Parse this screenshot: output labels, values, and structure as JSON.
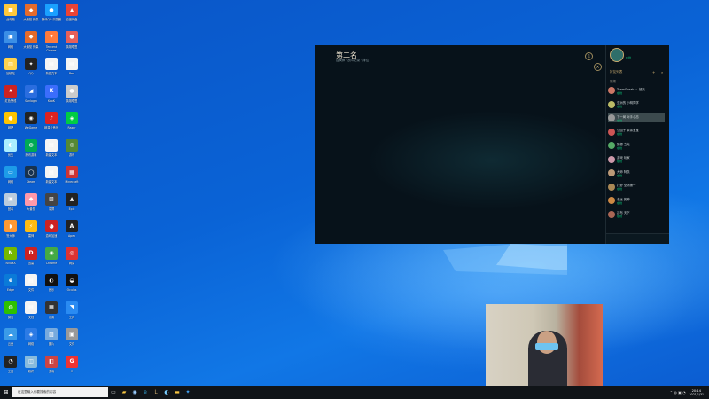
{
  "desktop": {
    "icons": [
      {
        "label": "此电脑",
        "color": "#ffc83d",
        "glyph": "■"
      },
      {
        "label": "大番茄 蜂巢",
        "color": "#e56b2c",
        "glyph": "◆"
      },
      {
        "label": "腾讯QQ 浏览器",
        "color": "#1aa0ff",
        "glyph": "●"
      },
      {
        "label": "百度网盘",
        "color": "#ea4335",
        "glyph": "▲"
      },
      {
        "label": "网络",
        "color": "#3a8ee6",
        "glyph": "▣"
      },
      {
        "label": "大番茄 蜂巢",
        "color": "#e56b2c",
        "glyph": "◆"
      },
      {
        "label": "Tencent Games",
        "color": "#ff7a3d",
        "glyph": "✦"
      },
      {
        "label": "英雄联盟",
        "color": "#e6605a",
        "glyph": "●"
      },
      {
        "label": "回收站",
        "color": "#ffd24d",
        "glyph": "▥"
      },
      {
        "label": "QQ",
        "color": "#222",
        "glyph": "✦"
      },
      {
        "label": "新建文本",
        "color": "#f4f4f4",
        "glyph": "▤"
      },
      {
        "label": "Red",
        "color": "#f4f4f4",
        "glyph": "▤"
      },
      {
        "label": "红色警戒",
        "color": "#c22",
        "glyph": "★"
      },
      {
        "label": "Sunlogin",
        "color": "#2a6ddf",
        "glyph": "◢"
      },
      {
        "label": "KooK",
        "color": "#3b6dfc",
        "glyph": "K"
      },
      {
        "label": "英雄联盟",
        "color": "#ccc",
        "glyph": "●"
      },
      {
        "label": "网吧",
        "color": "#ffc400",
        "glyph": "●"
      },
      {
        "label": "WeGame",
        "color": "#222",
        "glyph": "◉"
      },
      {
        "label": "网易云音乐",
        "color": "#d22",
        "glyph": "♪"
      },
      {
        "label": "Razer",
        "color": "#0c4",
        "glyph": "◈"
      },
      {
        "label": "优先",
        "color": "#aef",
        "glyph": "◐"
      },
      {
        "label": "腾讯游戏",
        "color": "#0a5",
        "glyph": "◍"
      },
      {
        "label": "新建文本",
        "color": "#f4f4f4",
        "glyph": "▤"
      },
      {
        "label": "游戏",
        "color": "#583",
        "glyph": "◎"
      },
      {
        "label": "网络",
        "color": "#1d9be8",
        "glyph": "▭"
      },
      {
        "label": "Steam",
        "color": "#17324f",
        "glyph": "◯"
      },
      {
        "label": "新建文本",
        "color": "#f4f4f4",
        "glyph": "▤"
      },
      {
        "label": "Minecraft",
        "color": "#c33",
        "glyph": "▦"
      },
      {
        "label": "回收",
        "color": "#bcd",
        "glyph": "▣"
      },
      {
        "label": "大番茄",
        "color": "#f9a",
        "glyph": "◆"
      },
      {
        "label": "录屏",
        "color": "#444",
        "glyph": "▧"
      },
      {
        "label": "Epic",
        "color": "#222",
        "glyph": "▲"
      },
      {
        "label": "鲁大师",
        "color": "#f93",
        "glyph": "◗"
      },
      {
        "label": "雷神",
        "color": "#fb1",
        "glyph": "⚡"
      },
      {
        "label": "游戏加速",
        "color": "#c22",
        "glyph": "◕"
      },
      {
        "label": "Apex",
        "color": "#222",
        "glyph": "A"
      },
      {
        "label": "NVIDIA",
        "color": "#76b900",
        "glyph": "N"
      },
      {
        "label": "迅雷",
        "color": "#c22",
        "glyph": "D"
      },
      {
        "label": "Chrome",
        "color": "#4a4",
        "glyph": "◉"
      },
      {
        "label": "网易",
        "color": "#d33",
        "glyph": "◎"
      },
      {
        "label": "Edge",
        "color": "#0a7ad8",
        "glyph": "e"
      },
      {
        "label": "文件",
        "color": "#f4f4f4",
        "glyph": "▤"
      },
      {
        "label": "音乐",
        "color": "#111",
        "glyph": "◐"
      },
      {
        "label": "Oculus",
        "color": "#111",
        "glyph": "◒"
      },
      {
        "label": "微信",
        "color": "#2dc100",
        "glyph": "◍"
      },
      {
        "label": "文档",
        "color": "#f4f4f4",
        "glyph": "▤"
      },
      {
        "label": "设置",
        "color": "#333",
        "glyph": "▦"
      },
      {
        "label": "工具",
        "color": "#2a8bf2",
        "glyph": "◥"
      },
      {
        "label": "云盘",
        "color": "#3a9be8",
        "glyph": "☁"
      },
      {
        "label": "网络",
        "color": "#2c7be5",
        "glyph": "◈"
      },
      {
        "label": "图片",
        "color": "#7ad",
        "glyph": "▨"
      },
      {
        "label": "文件",
        "color": "#999",
        "glyph": "▣"
      },
      {
        "label": "工具",
        "color": "#222",
        "glyph": "◔"
      },
      {
        "label": "软件",
        "color": "#8bd",
        "glyph": "◫"
      },
      {
        "label": "游戏",
        "color": "#c44",
        "glyph": "◧"
      },
      {
        "label": "G",
        "color": "#e33",
        "glyph": "G"
      }
    ]
  },
  "game": {
    "title": "第二名",
    "subtitle": "召唤师 · 战斗记录 · 排位",
    "friends_header": "好友列表",
    "group_label": "常规",
    "online_label": "在线",
    "friends": [
      {
        "name": "TeamSpeak 丶 超天",
        "status": "在线",
        "color": "#c76"
      },
      {
        "name": "亚洲的 小明同学",
        "status": "在线",
        "color": "#bb6"
      },
      {
        "name": "下一局 对手心态",
        "status": "在线",
        "color": "#999"
      },
      {
        "name": "公园子 亲亲宝宝",
        "status": "在线",
        "color": "#c55"
      },
      {
        "name": "梦想 之光",
        "status": "在线",
        "color": "#5a6"
      },
      {
        "name": "游戏 玩家",
        "status": "在线",
        "color": "#c9a"
      },
      {
        "name": "大师 阿凯",
        "status": "在线",
        "color": "#b97"
      },
      {
        "name": "打野 全场第一",
        "status": "在线",
        "color": "#a85"
      },
      {
        "name": "永远 的神",
        "status": "在线",
        "color": "#c84"
      },
      {
        "name": "吕布 天下",
        "status": "在线",
        "color": "#a65"
      }
    ]
  },
  "taskbar": {
    "search_placeholder": "在这里输入你要搜索的内容",
    "time": "20:14",
    "date": "2021/1/31"
  }
}
